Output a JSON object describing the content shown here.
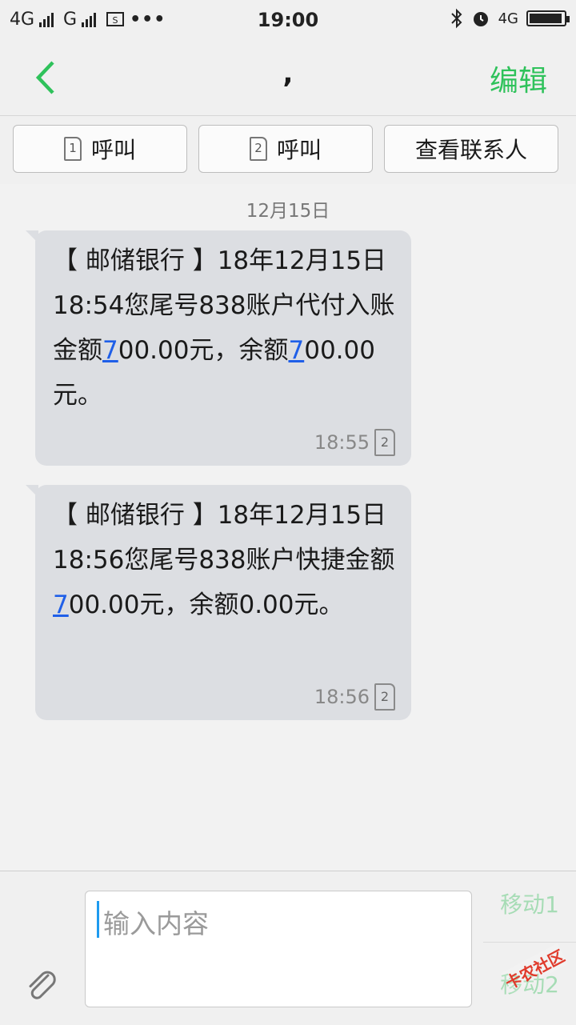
{
  "status_bar": {
    "network_1": "4G",
    "network_2": "G",
    "time": "19:00",
    "network_right": "4G",
    "battery_level": 0.95
  },
  "header": {
    "title": ",",
    "edit_label": "编辑"
  },
  "actions": {
    "call_sim1_label": "呼叫",
    "call_sim2_label": "呼叫",
    "sim1_badge": "1",
    "sim2_badge": "2",
    "view_contact_label": "查看联系人"
  },
  "conversation": {
    "date": "12月15日",
    "messages": [
      {
        "parts": [
          "【 邮储银行 】18年12月15日18:54您尾号838账户代付入账金额",
          "7",
          "00.00元，余额",
          "7",
          "00.00元。"
        ],
        "time": "18:55",
        "sim": "2"
      },
      {
        "parts": [
          "【 邮储银行 】18年12月15日18:56您尾号838账户快捷金额",
          "7",
          "00.00元，余额0.00元。"
        ],
        "time": "18:56",
        "sim": "2"
      }
    ]
  },
  "composer": {
    "placeholder": "输入内容",
    "send_sim1_label": "移动1",
    "send_sim2_label": "移动2",
    "watermark": "卡农社区"
  },
  "colors": {
    "accent": "#2fc25b",
    "bubble": "#dcdee2",
    "link": "#1f5fe8"
  }
}
